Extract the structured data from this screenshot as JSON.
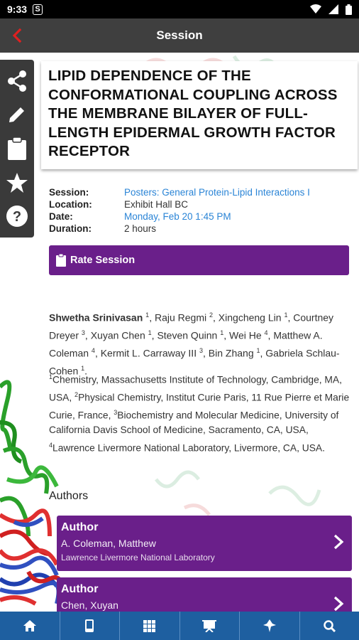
{
  "status_bar": {
    "time": "9:33",
    "app_icon": "S"
  },
  "header": {
    "title": "Session",
    "back_icon": "back-arrow-icon"
  },
  "side_tools": [
    "share-icon",
    "edit-icon",
    "clipboard-icon",
    "star-icon",
    "help-icon"
  ],
  "session": {
    "title": "LIPID DEPENDENCE OF THE CONFORMATIONAL COUPLING ACROSS THE MEMBRANE BILAYER OF FULL-LENGTH EPIDERMAL GROWTH FACTOR RECEPTOR",
    "session_label": "Session:",
    "session_value": "Posters: General Protein-Lipid Interactions I",
    "location_label": "Location:",
    "location_value": "Exhibit Hall BC",
    "date_label": "Date:",
    "date_value": "Monday, Feb 20 1:45 PM",
    "duration_label": "Duration:",
    "duration_value": "2 hours"
  },
  "rate_button": {
    "label": "Rate Session"
  },
  "authors_list": {
    "first_author": "Shwetha Srinivasan",
    "authors": [
      {
        "name": "Shwetha Srinivasan",
        "sup": "1"
      },
      {
        "name": "Raju Regmi",
        "sup": "2"
      },
      {
        "name": "Xingcheng Lin",
        "sup": "1"
      },
      {
        "name": "Courtney Dreyer",
        "sup": "3"
      },
      {
        "name": "Xuyan Chen",
        "sup": "1"
      },
      {
        "name": "Steven Quinn",
        "sup": "1"
      },
      {
        "name": "Wei He",
        "sup": "4"
      },
      {
        "name": "Matthew A. Coleman",
        "sup": "4"
      },
      {
        "name": "Kermit L. Carraway III",
        "sup": "3"
      },
      {
        "name": "Bin Zhang",
        "sup": "1"
      },
      {
        "name": "Gabriela Schlau-Cohen",
        "sup": "1"
      }
    ],
    "affiliations": [
      {
        "sup": "1",
        "text": "Chemistry, Massachusetts Institute of Technology, Cambridge, MA, USA"
      },
      {
        "sup": "2",
        "text": "Physical Chemistry, Institut Curie Paris, 11 Rue Pierre et Marie Curie, France"
      },
      {
        "sup": "3",
        "text": "Biochemistry and Molecular Medicine, University of California Davis School of Medicine, Sacramento, CA, USA"
      },
      {
        "sup": "4",
        "text": "Lawrence Livermore National Laboratory, Livermore, CA, USA."
      }
    ]
  },
  "authors_section": {
    "heading": "Authors",
    "cards": [
      {
        "role": "Author",
        "name": "A. Coleman, Matthew",
        "org": "Lawrence Livermore National Laboratory"
      },
      {
        "role": "Author",
        "name": "Chen, Xuyan",
        "org": ""
      }
    ]
  },
  "bottom_nav": [
    "home-icon",
    "mobile-icon",
    "grid-icon",
    "presentation-icon",
    "map-pin-icon",
    "search-icon"
  ],
  "colors": {
    "accent": "#6a1f8a",
    "nav": "#1e5fa0",
    "app_bar": "#3f3f3f",
    "link": "#2a84d6",
    "back": "#e02020"
  }
}
